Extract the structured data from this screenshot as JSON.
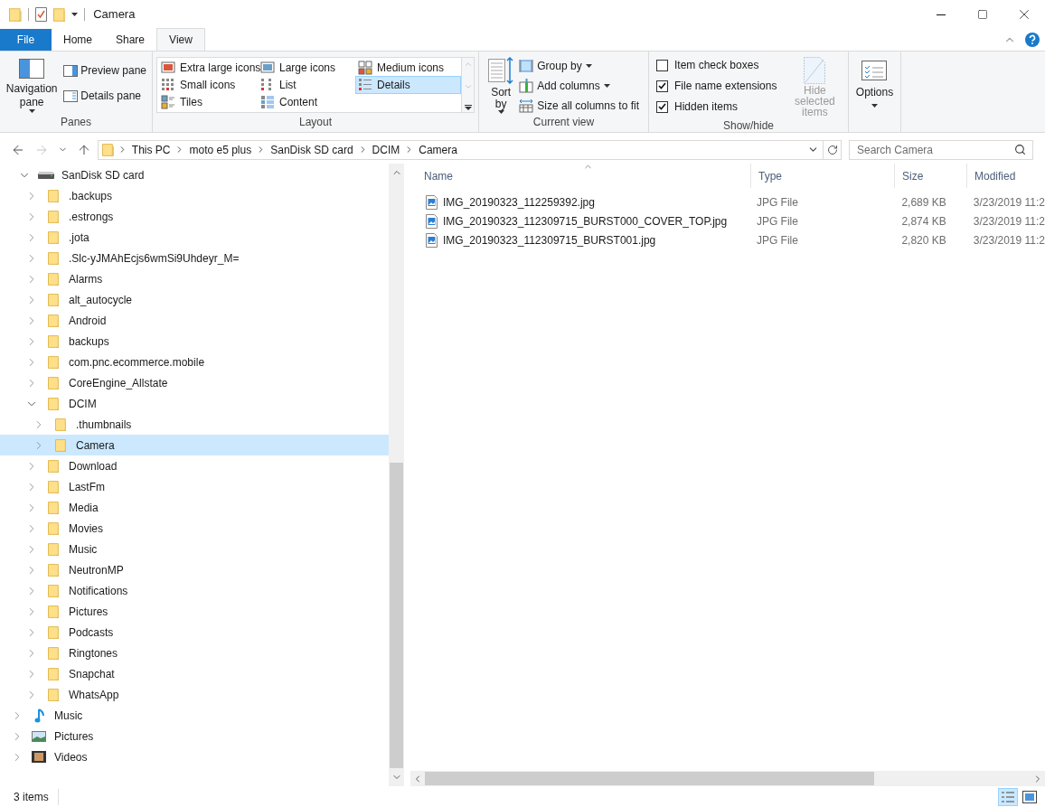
{
  "title_bar": {
    "title": "Camera"
  },
  "ribbon": {
    "tabs": [
      {
        "label": "File",
        "kind": "file",
        "selected": false
      },
      {
        "label": "Home",
        "kind": "tab",
        "selected": false
      },
      {
        "label": "Share",
        "kind": "tab",
        "selected": false
      },
      {
        "label": "View",
        "kind": "tab",
        "selected": true
      }
    ],
    "panes": {
      "label": "Panes",
      "navigation": "Navigation pane",
      "preview": "Preview pane",
      "details": "Details pane"
    },
    "layout": {
      "label": "Layout",
      "options": [
        {
          "label": "Extra large icons",
          "kind": "xl",
          "selected": false
        },
        {
          "label": "Large icons",
          "kind": "large",
          "selected": false
        },
        {
          "label": "Medium icons",
          "kind": "medium",
          "selected": false
        },
        {
          "label": "Small icons",
          "kind": "small",
          "selected": false
        },
        {
          "label": "List",
          "kind": "list",
          "selected": false
        },
        {
          "label": "Details",
          "kind": "details",
          "selected": true
        },
        {
          "label": "Tiles",
          "kind": "tiles",
          "selected": false
        },
        {
          "label": "Content",
          "kind": "content",
          "selected": false
        }
      ]
    },
    "current_view": {
      "label": "Current view",
      "sort_by": "Sort by",
      "buttons": [
        {
          "label": "Group by",
          "kind": "group",
          "dropdown": true
        },
        {
          "label": "Add columns",
          "kind": "columns",
          "dropdown": true
        },
        {
          "label": "Size all columns to fit",
          "kind": "fit",
          "dropdown": false
        }
      ]
    },
    "show_hide": {
      "label": "Show/hide",
      "checkboxes": [
        {
          "label": "Item check boxes",
          "checked": false
        },
        {
          "label": "File name extensions",
          "checked": true
        },
        {
          "label": "Hidden items",
          "checked": true
        }
      ],
      "hide_selected": {
        "label": "Hide selected items",
        "disabled": true
      }
    },
    "options": {
      "label": "Options"
    }
  },
  "address_bar": {
    "back": {
      "disabled": false
    },
    "forward": {
      "disabled": true
    },
    "crumbs": [
      "This PC",
      "moto e5 plus",
      "SanDisk SD card",
      "DCIM",
      "Camera"
    ],
    "search": {
      "placeholder": "Search Camera"
    }
  },
  "navigation_tree": [
    {
      "label": "SanDisk SD card",
      "kind": "drive",
      "expanded": true,
      "selected": false,
      "children": [
        {
          "label": ".backups",
          "kind": "folder",
          "expanded": false,
          "selected": false
        },
        {
          "label": ".estrongs",
          "kind": "folder",
          "expanded": false,
          "selected": false
        },
        {
          "label": ".jota",
          "kind": "folder",
          "expanded": false,
          "selected": false
        },
        {
          "label": ".Slc-yJMAhEcjs6wmSi9Uhdeyr_M=",
          "kind": "folder",
          "expanded": false,
          "selected": false
        },
        {
          "label": "Alarms",
          "kind": "folder",
          "expanded": false,
          "selected": false
        },
        {
          "label": "alt_autocycle",
          "kind": "folder",
          "expanded": false,
          "selected": false
        },
        {
          "label": "Android",
          "kind": "folder",
          "expanded": false,
          "selected": false
        },
        {
          "label": "backups",
          "kind": "folder",
          "expanded": false,
          "selected": false
        },
        {
          "label": "com.pnc.ecommerce.mobile",
          "kind": "folder",
          "expanded": false,
          "selected": false
        },
        {
          "label": "CoreEngine_Allstate",
          "kind": "folder",
          "expanded": false,
          "selected": false
        },
        {
          "label": "DCIM",
          "kind": "folder",
          "expanded": true,
          "selected": false,
          "children": [
            {
              "label": ".thumbnails",
              "kind": "folder",
              "expanded": false,
              "selected": false
            },
            {
              "label": "Camera",
              "kind": "folder",
              "expanded": false,
              "selected": true
            }
          ]
        },
        {
          "label": "Download",
          "kind": "folder",
          "expanded": false,
          "selected": false
        },
        {
          "label": "LastFm",
          "kind": "folder",
          "expanded": false,
          "selected": false
        },
        {
          "label": "Media",
          "kind": "folder",
          "expanded": false,
          "selected": false
        },
        {
          "label": "Movies",
          "kind": "folder",
          "expanded": false,
          "selected": false
        },
        {
          "label": "Music",
          "kind": "folder",
          "expanded": false,
          "selected": false
        },
        {
          "label": "NeutronMP",
          "kind": "folder",
          "expanded": false,
          "selected": false
        },
        {
          "label": "Notifications",
          "kind": "folder",
          "expanded": false,
          "selected": false
        },
        {
          "label": "Pictures",
          "kind": "folder",
          "expanded": false,
          "selected": false
        },
        {
          "label": "Podcasts",
          "kind": "folder",
          "expanded": false,
          "selected": false
        },
        {
          "label": "Ringtones",
          "kind": "folder",
          "expanded": false,
          "selected": false
        },
        {
          "label": "Snapchat",
          "kind": "folder",
          "expanded": false,
          "selected": false
        },
        {
          "label": "WhatsApp",
          "kind": "folder",
          "expanded": false,
          "selected": false
        }
      ]
    },
    {
      "label": "Music",
      "kind": "music",
      "expanded": false,
      "selected": false
    },
    {
      "label": "Pictures",
      "kind": "pictures",
      "expanded": false,
      "selected": false
    },
    {
      "label": "Videos",
      "kind": "videos",
      "expanded": false,
      "selected": false
    }
  ],
  "file_list": {
    "columns": [
      "Name",
      "Type",
      "Size",
      "Modified"
    ],
    "rows": [
      {
        "name": "IMG_20190323_112259392.jpg",
        "type": "JPG File",
        "size": "2,689 KB",
        "modified": "3/23/2019 11:2"
      },
      {
        "name": "IMG_20190323_112309715_BURST000_COVER_TOP.jpg",
        "type": "JPG File",
        "size": "2,874 KB",
        "modified": "3/23/2019 11:2"
      },
      {
        "name": "IMG_20190323_112309715_BURST001.jpg",
        "type": "JPG File",
        "size": "2,820 KB",
        "modified": "3/23/2019 11:2"
      }
    ]
  },
  "status_bar": {
    "text": "3 items",
    "view_buttons": [
      {
        "kind": "details",
        "selected": true
      },
      {
        "kind": "large",
        "selected": false
      }
    ]
  }
}
